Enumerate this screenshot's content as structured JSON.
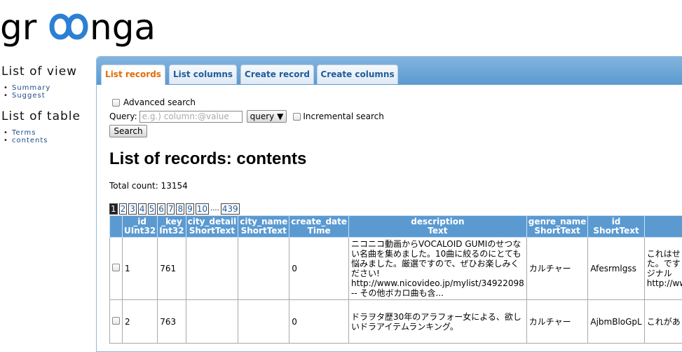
{
  "logo": {
    "text": "groonga"
  },
  "sidebar": {
    "view_heading": "List of view",
    "view_items": [
      "Summary",
      "Suggest"
    ],
    "table_heading": "List of table",
    "table_items": [
      "Terms",
      "contents"
    ]
  },
  "tabs": [
    {
      "label": "List records",
      "active": true
    },
    {
      "label": "List columns",
      "active": false
    },
    {
      "label": "Create record",
      "active": false
    },
    {
      "label": "Create columns",
      "active": false
    }
  ],
  "search": {
    "advanced_label": "Advanced search",
    "query_label": "Query:",
    "placeholder": "e.g.) column:@value",
    "mode": "query ▼",
    "incremental_label": "Incremental search",
    "button": "Search"
  },
  "main": {
    "title": "List of records: contents",
    "total": "Total count: 13154"
  },
  "pager": {
    "pages": [
      "1",
      "2",
      "3",
      "4",
      "5",
      "6",
      "7",
      "8",
      "9",
      "10"
    ],
    "current": "1",
    "ellipsis": "....",
    "last": "439"
  },
  "table": {
    "columns": [
      {
        "name": "",
        "type": ""
      },
      {
        "name": "_id",
        "type": "UInt32"
      },
      {
        "name": "_key",
        "type": "Int32"
      },
      {
        "name": "city_detail",
        "type": "ShortText"
      },
      {
        "name": "city_name",
        "type": "ShortText"
      },
      {
        "name": "create_date",
        "type": "Time"
      },
      {
        "name": "description",
        "type": "Text"
      },
      {
        "name": "genre_name",
        "type": "ShortText"
      },
      {
        "name": "id",
        "type": "ShortText"
      },
      {
        "name": "",
        "type": ""
      }
    ],
    "rows": [
      {
        "id": "1",
        "key": "761",
        "city_detail": "",
        "city_name": "",
        "create_date": "0",
        "description": "ニコニコ動画からVOCALOID GUMIのせつない名曲を集めました。10曲に絞るのにとても悩みました。厳選ですので、ぜひお楽しみください! http://www.nicovideo.jp/mylist/34922098 -- その他ボカロ曲も含...",
        "genre_name": "カルチャー",
        "rid": "Afesrmlgss",
        "extra": "これはせた。です リジナル http://www"
      },
      {
        "id": "2",
        "key": "763",
        "city_detail": "",
        "city_name": "",
        "create_date": "0",
        "description": "ドラヲタ歴30年のアラフォー女による、欲しいドラアイテムランキング。",
        "genre_name": "カルチャー",
        "rid": "AjbmBloGpL",
        "extra": "これがあ"
      }
    ]
  }
}
